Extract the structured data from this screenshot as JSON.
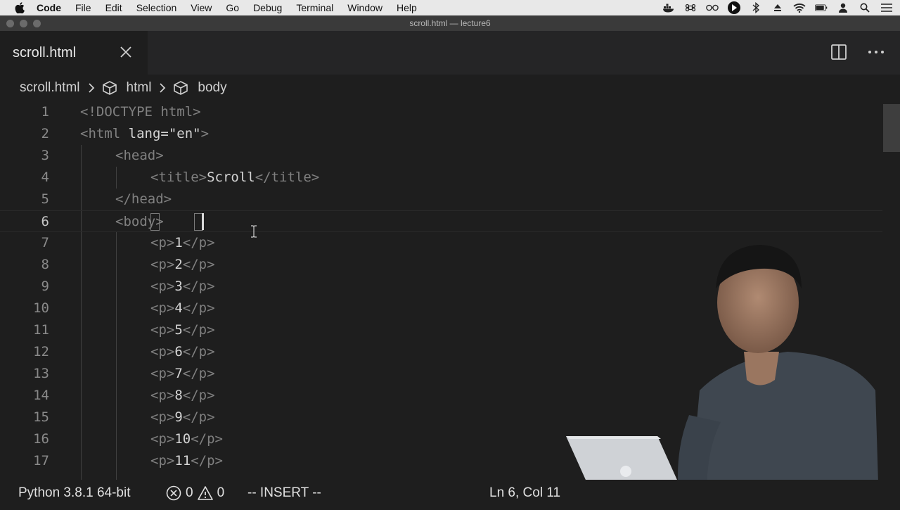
{
  "menubar": {
    "app_name": "Code",
    "items": [
      "File",
      "Edit",
      "Selection",
      "View",
      "Go",
      "Debug",
      "Terminal",
      "Window",
      "Help"
    ]
  },
  "window": {
    "title": "scroll.html — lecture6"
  },
  "tab": {
    "label": "scroll.html"
  },
  "breadcrumb": {
    "file": "scroll.html",
    "items": [
      "html",
      "body"
    ]
  },
  "editor": {
    "lines": [
      {
        "n": "1",
        "indent": 0,
        "parts": [
          [
            "tag",
            "<!DOCTYPE html>"
          ]
        ]
      },
      {
        "n": "2",
        "indent": 0,
        "parts": [
          [
            "tag",
            "<html "
          ],
          [
            "txt",
            "lang=\"en\""
          ],
          [
            "tag",
            ">"
          ]
        ]
      },
      {
        "n": "3",
        "indent": 1,
        "parts": [
          [
            "tag",
            "<head>"
          ]
        ]
      },
      {
        "n": "4",
        "indent": 2,
        "parts": [
          [
            "tag",
            "<title>"
          ],
          [
            "txt",
            "Scroll"
          ],
          [
            "tag",
            "</title>"
          ]
        ]
      },
      {
        "n": "5",
        "indent": 1,
        "parts": [
          [
            "tag",
            "</head>"
          ]
        ]
      },
      {
        "n": "6",
        "indent": 1,
        "parts": [
          [
            "tag",
            "<body>"
          ]
        ],
        "current": true
      },
      {
        "n": "7",
        "indent": 2,
        "parts": [
          [
            "tag",
            "<p>"
          ],
          [
            "txt",
            "1"
          ],
          [
            "tag",
            "</p>"
          ]
        ]
      },
      {
        "n": "8",
        "indent": 2,
        "parts": [
          [
            "tag",
            "<p>"
          ],
          [
            "txt",
            "2"
          ],
          [
            "tag",
            "</p>"
          ]
        ]
      },
      {
        "n": "9",
        "indent": 2,
        "parts": [
          [
            "tag",
            "<p>"
          ],
          [
            "txt",
            "3"
          ],
          [
            "tag",
            "</p>"
          ]
        ]
      },
      {
        "n": "10",
        "indent": 2,
        "parts": [
          [
            "tag",
            "<p>"
          ],
          [
            "txt",
            "4"
          ],
          [
            "tag",
            "</p>"
          ]
        ]
      },
      {
        "n": "11",
        "indent": 2,
        "parts": [
          [
            "tag",
            "<p>"
          ],
          [
            "txt",
            "5"
          ],
          [
            "tag",
            "</p>"
          ]
        ]
      },
      {
        "n": "12",
        "indent": 2,
        "parts": [
          [
            "tag",
            "<p>"
          ],
          [
            "txt",
            "6"
          ],
          [
            "tag",
            "</p>"
          ]
        ]
      },
      {
        "n": "13",
        "indent": 2,
        "parts": [
          [
            "tag",
            "<p>"
          ],
          [
            "txt",
            "7"
          ],
          [
            "tag",
            "</p>"
          ]
        ]
      },
      {
        "n": "14",
        "indent": 2,
        "parts": [
          [
            "tag",
            "<p>"
          ],
          [
            "txt",
            "8"
          ],
          [
            "tag",
            "</p>"
          ]
        ]
      },
      {
        "n": "15",
        "indent": 2,
        "parts": [
          [
            "tag",
            "<p>"
          ],
          [
            "txt",
            "9"
          ],
          [
            "tag",
            "</p>"
          ]
        ]
      },
      {
        "n": "16",
        "indent": 2,
        "parts": [
          [
            "tag",
            "<p>"
          ],
          [
            "txt",
            "10"
          ],
          [
            "tag",
            "</p>"
          ]
        ]
      },
      {
        "n": "17",
        "indent": 2,
        "parts": [
          [
            "tag",
            "<p>"
          ],
          [
            "txt",
            "11"
          ],
          [
            "tag",
            "</p>"
          ]
        ]
      }
    ]
  },
  "statusbar": {
    "python": "Python 3.8.1 64-bit",
    "errors": "0",
    "warnings": "0",
    "mode": "-- INSERT --",
    "position": "Ln 6, Col 11"
  },
  "colors": {
    "editor_bg": "#1e1e1e",
    "tag_gray": "#808080",
    "text": "#d4d4d4",
    "menubar_bg": "#e8e8e8"
  }
}
